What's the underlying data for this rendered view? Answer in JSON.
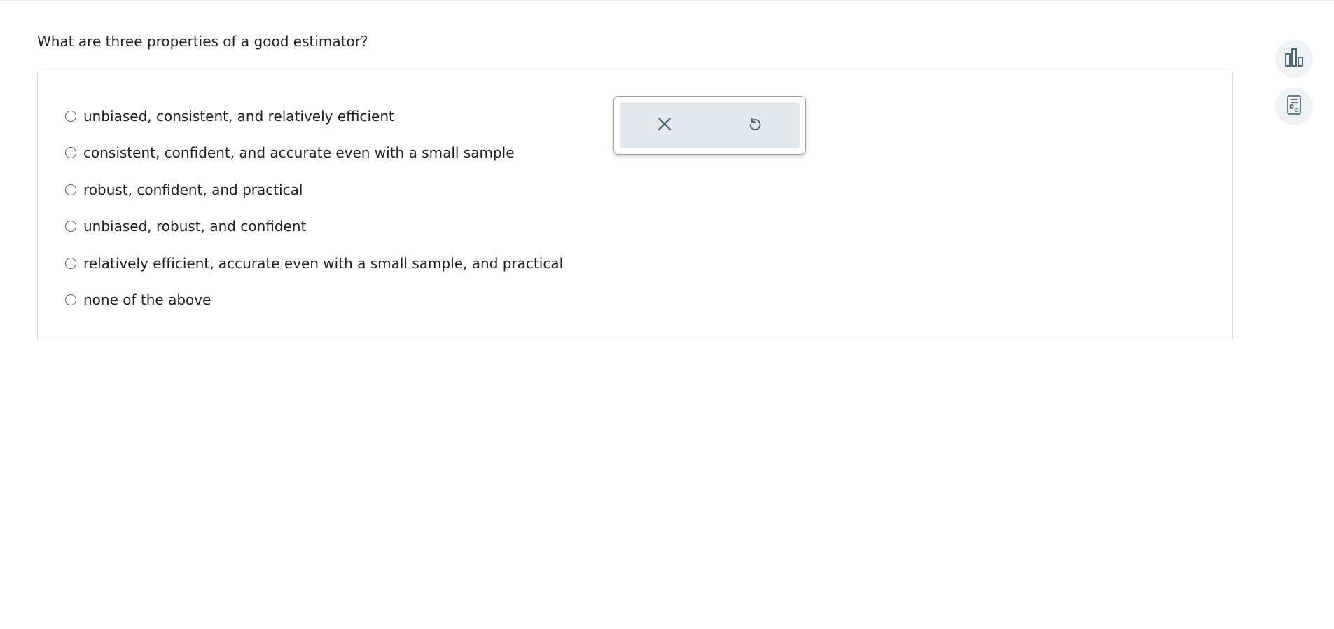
{
  "question": {
    "text": "What are three properties of a good estimator?"
  },
  "options": [
    {
      "label": "unbiased, consistent, and relatively efficient",
      "selected": false
    },
    {
      "label": "consistent, confident, and accurate even with a small sample",
      "selected": false
    },
    {
      "label": "robust, confident, and practical",
      "selected": false
    },
    {
      "label": "unbiased, robust, and confident",
      "selected": false
    },
    {
      "label": "relatively efficient, accurate even with a small sample, and practical",
      "selected": false
    },
    {
      "label": "none of the above",
      "selected": false
    }
  ],
  "popup": {
    "clear_icon": "close-icon",
    "reset_icon": "undo-icon"
  },
  "sidebar": {
    "tools": [
      {
        "icon": "bar-chart-icon"
      },
      {
        "icon": "calculator-icon"
      }
    ]
  },
  "colors": {
    "icon": "#3f5c6b",
    "popup_bg": "#e2e8eb",
    "side_button_bg": "#eef2f4",
    "panel_border": "#d6d9dc"
  }
}
